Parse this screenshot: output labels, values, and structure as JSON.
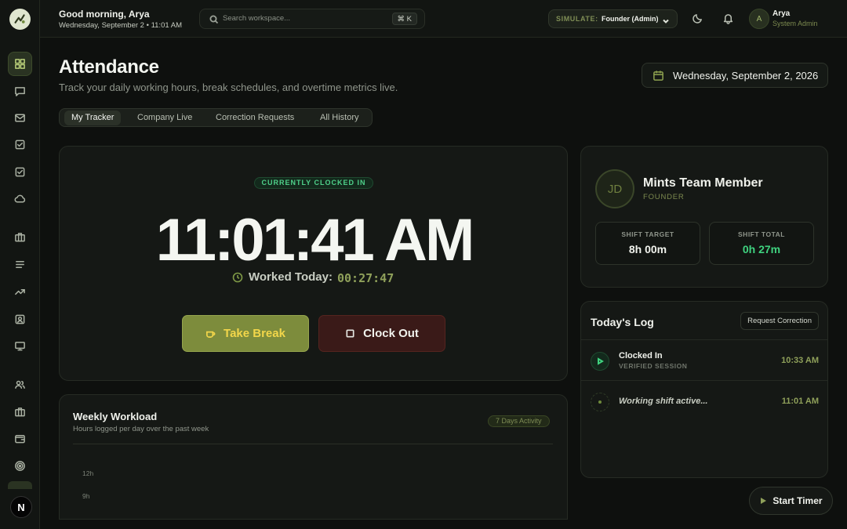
{
  "header": {
    "greeting": "Good morning, Arya",
    "datetime": "Wednesday, September 2 • 11:01 AM",
    "search_placeholder": "Search workspace...",
    "search_shortcut": "⌘ K",
    "simulate_label": "SIMULATE:",
    "simulate_value": "Founder (Admin)",
    "user_initial": "A",
    "user_name": "Arya",
    "user_role": "System Admin"
  },
  "sidebar": {
    "items": [
      {
        "icon": "dashboard-icon"
      },
      {
        "icon": "chat-icon"
      },
      {
        "icon": "mail-icon"
      },
      {
        "icon": "task-check-icon"
      },
      {
        "icon": "approvals-check-icon"
      },
      {
        "icon": "cloud-icon"
      },
      {
        "icon": "briefcase-icon"
      },
      {
        "icon": "list-icon"
      },
      {
        "icon": "trending-icon"
      },
      {
        "icon": "profile-card-icon"
      },
      {
        "icon": "monitor-icon"
      },
      {
        "icon": "users-icon"
      },
      {
        "icon": "portfolio-icon"
      },
      {
        "icon": "wallet-icon"
      },
      {
        "icon": "target-icon"
      }
    ],
    "user_initial": "N"
  },
  "page": {
    "title": "Attendance",
    "subtitle": "Track your daily working hours, break schedules, and overtime metrics live.",
    "date": "Wednesday, September 2, 2026",
    "tabs": [
      {
        "label": "My Tracker",
        "active": true
      },
      {
        "label": "Company Live",
        "active": false
      },
      {
        "label": "Correction Requests",
        "active": false
      },
      {
        "label": "All History",
        "active": false
      }
    ]
  },
  "tracker": {
    "status": "CURRENTLY CLOCKED IN",
    "time": "11:01:41 AM",
    "worked_label": "Worked Today:",
    "worked_value": "00:27:47",
    "break_label": "Take Break",
    "clockout_label": "Clock Out"
  },
  "weekly": {
    "title": "Weekly Workload",
    "subtitle": "Hours logged per day over the past week",
    "badge": "7 Days Activity",
    "y_ticks": [
      "12h",
      "9h"
    ]
  },
  "profile": {
    "initials": "JD",
    "name": "Mints Team Member",
    "role": "FOUNDER",
    "shift_target_label": "SHIFT TARGET",
    "shift_target_value": "8h 00m",
    "shift_total_label": "SHIFT TOTAL",
    "shift_total_value": "0h 27m"
  },
  "log": {
    "title": "Today's Log",
    "request_label": "Request Correction",
    "entries": [
      {
        "event": "Clocked In",
        "meta": "VERIFIED SESSION",
        "time": "10:33 AM"
      },
      {
        "event": "Working shift active...",
        "meta": "",
        "time": "11:01 AM"
      }
    ]
  },
  "fab": {
    "label": "Start Timer"
  },
  "colors": {
    "accent": "#7d8c3c",
    "accent_text": "#f2d64a",
    "status_green": "#3fd27f",
    "danger_bg": "#3a1a18",
    "background": "#0e100e"
  }
}
